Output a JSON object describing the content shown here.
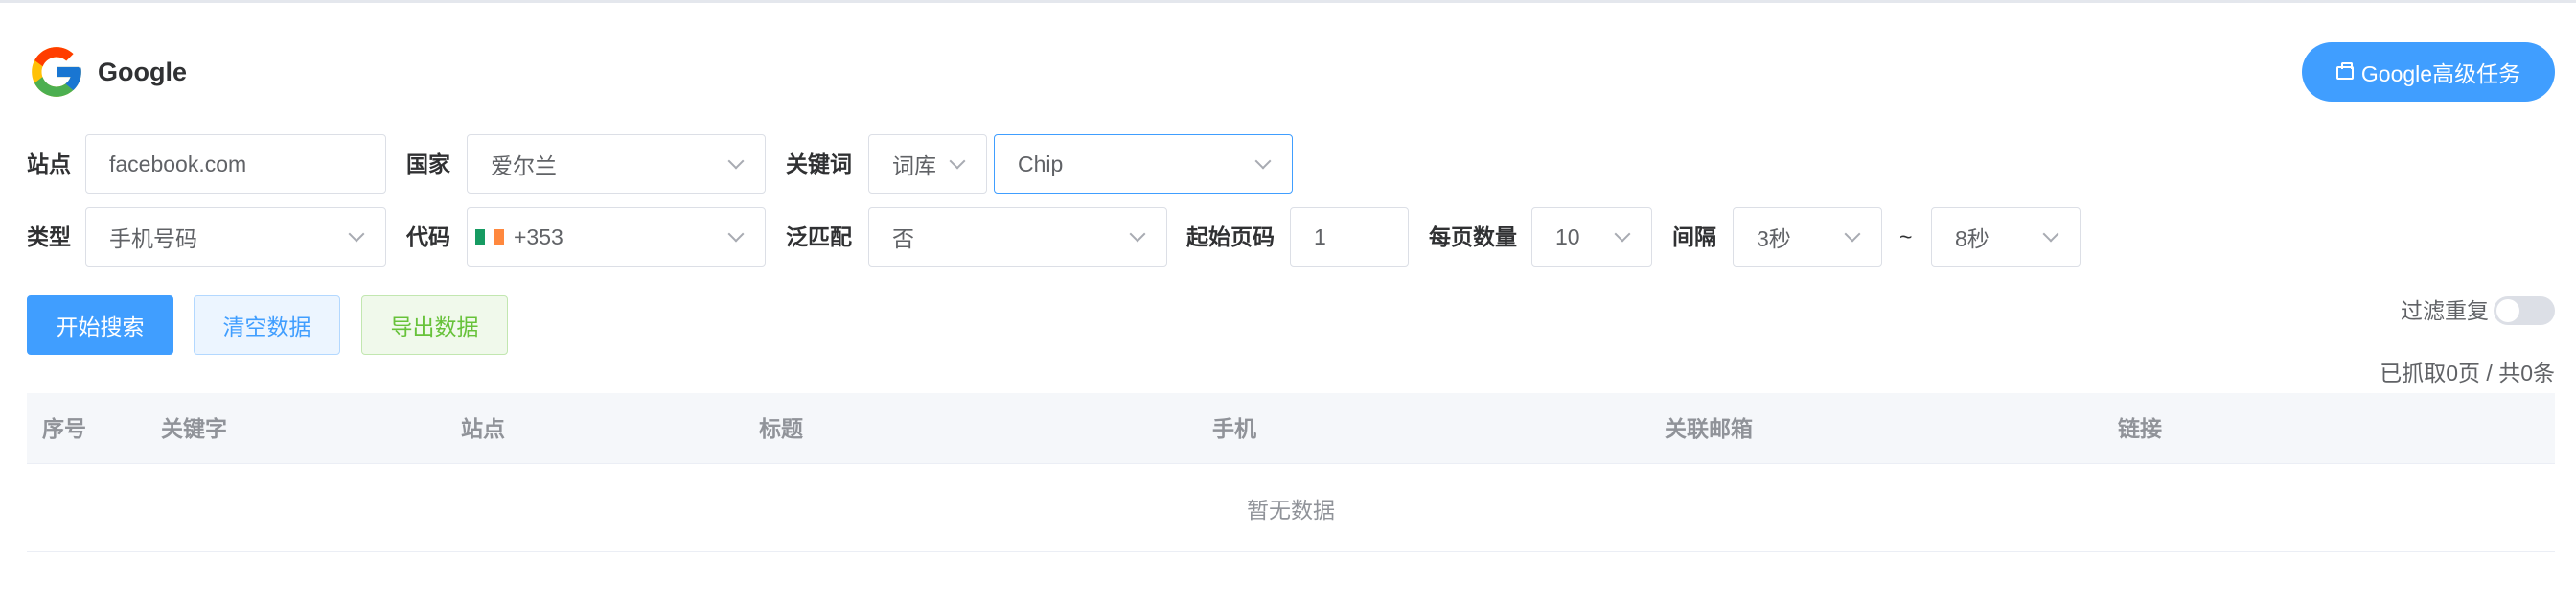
{
  "header": {
    "title": "Google",
    "logo_icon": "google-g-logo",
    "advanced_task_button": "Google高级任务",
    "advanced_task_icon": "bag-icon"
  },
  "form": {
    "site": {
      "label": "站点",
      "value": "facebook.com"
    },
    "country": {
      "label": "国家",
      "value": "爱尔兰"
    },
    "keyword": {
      "label": "关键词",
      "source_value": "词库",
      "value": "Chip"
    },
    "type": {
      "label": "类型",
      "value": "手机号码"
    },
    "code": {
      "label": "代码",
      "value": "+353",
      "flag_colors": [
        "#169b62",
        "#ffffff",
        "#ff883e"
      ]
    },
    "fuzzy": {
      "label": "泛匹配",
      "value": "否"
    },
    "start_page": {
      "label": "起始页码",
      "value": "1"
    },
    "per_page": {
      "label": "每页数量",
      "value": "10"
    },
    "interval": {
      "label": "间隔",
      "from": "3秒",
      "separator": "~",
      "to": "8秒"
    }
  },
  "actions": {
    "start_search": "开始搜索",
    "clear_data": "清空数据",
    "export_data": "导出数据",
    "filter_duplicates_label": "过滤重复",
    "filter_duplicates_on": false
  },
  "status": {
    "page_info": "已抓取0页 / 共0条"
  },
  "table": {
    "columns": [
      "序号",
      "关键字",
      "站点",
      "标题",
      "手机",
      "关联邮箱",
      "链接"
    ],
    "empty_text": "暂无数据"
  },
  "colors": {
    "primary": "#409eff",
    "success": "#67c23a"
  }
}
